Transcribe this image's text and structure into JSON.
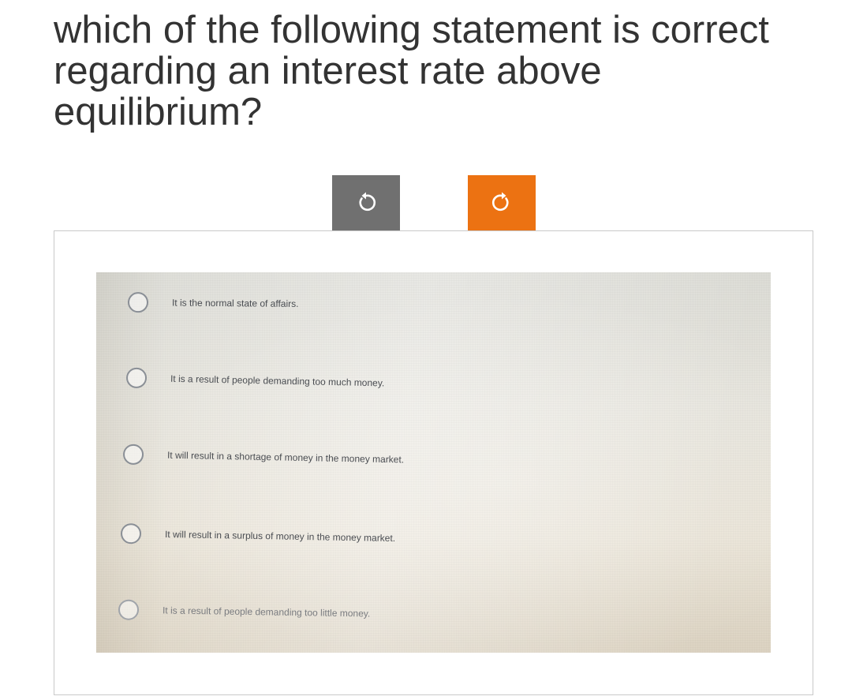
{
  "question": {
    "text": "which of the following statement is correct regarding an interest rate above equilibrium?"
  },
  "toolbar": {
    "undo_icon": "rotate-left-icon",
    "redo_icon": "rotate-right-icon",
    "undo_color": "#707070",
    "redo_color": "#ec7212"
  },
  "options": [
    {
      "label": "It is the normal state of affairs."
    },
    {
      "label": "It is a result of people demanding too much money."
    },
    {
      "label": "It will result in a shortage of money in the money market."
    },
    {
      "label": "It will result in a surplus of money in the money market."
    },
    {
      "label": "It is a result of people demanding too little money."
    }
  ]
}
